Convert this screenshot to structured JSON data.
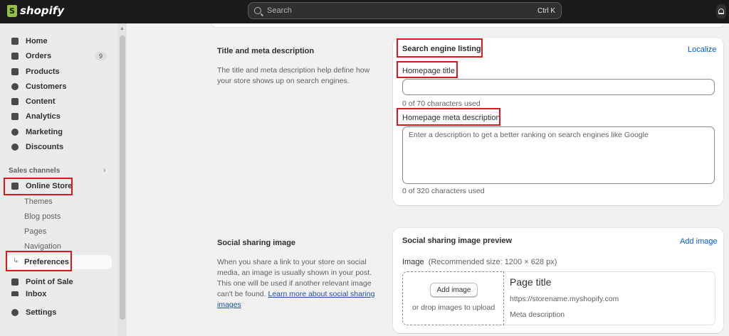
{
  "topbar": {
    "logo": "shopify",
    "search_placeholder": "Search",
    "search_shortcut": "Ctrl K"
  },
  "sidebar": {
    "items": [
      {
        "label": "Home",
        "icon": "home-icon"
      },
      {
        "label": "Orders",
        "icon": "orders-icon",
        "badge": "9"
      },
      {
        "label": "Products",
        "icon": "products-tag-icon"
      },
      {
        "label": "Customers",
        "icon": "customers-person-icon"
      },
      {
        "label": "Content",
        "icon": "content-icon"
      },
      {
        "label": "Analytics",
        "icon": "analytics-bars-icon"
      },
      {
        "label": "Marketing",
        "icon": "marketing-target-icon"
      },
      {
        "label": "Discounts",
        "icon": "discounts-gear-icon"
      }
    ],
    "sales_channels_label": "Sales channels",
    "online_store": "Online Store",
    "sub_items": [
      "Themes",
      "Blog posts",
      "Pages",
      "Navigation",
      "Preferences"
    ],
    "point_of_sale": "Point of Sale",
    "inbox": "Inbox",
    "settings": "Settings"
  },
  "seo_section": {
    "title": "Title and meta description",
    "description": "The title and meta description help define how your store shows up on search engines.",
    "card_heading": "Search engine listing",
    "action": "Localize",
    "homepage_title_label": "Homepage title",
    "homepage_title_value": "",
    "title_help": "0 of 70 characters used",
    "meta_label": "Homepage meta description",
    "meta_placeholder": "Enter a description to get a better ranking on search engines like Google",
    "meta_help": "0 of 320 characters used"
  },
  "social_section": {
    "title": "Social sharing image",
    "description": "When you share a link to your store on social media, an image is usually shown in your post. This one will be used if another relevant image can't be found.",
    "link_text": "Learn more about social sharing images",
    "card_heading": "Social sharing image preview",
    "action": "Add image",
    "image_label": "Image",
    "image_hint": "(Recommended size: 1200 × 628 px)",
    "add_image_button": "Add image",
    "drop_text": "or drop images to upload",
    "preview_title": "Page title",
    "preview_url": "https://storename.myshopify.com",
    "preview_meta": "Meta description"
  },
  "colors": {
    "highlight": "#e0161e",
    "link": "#005bd3",
    "topbar": "#1a1a1a"
  }
}
